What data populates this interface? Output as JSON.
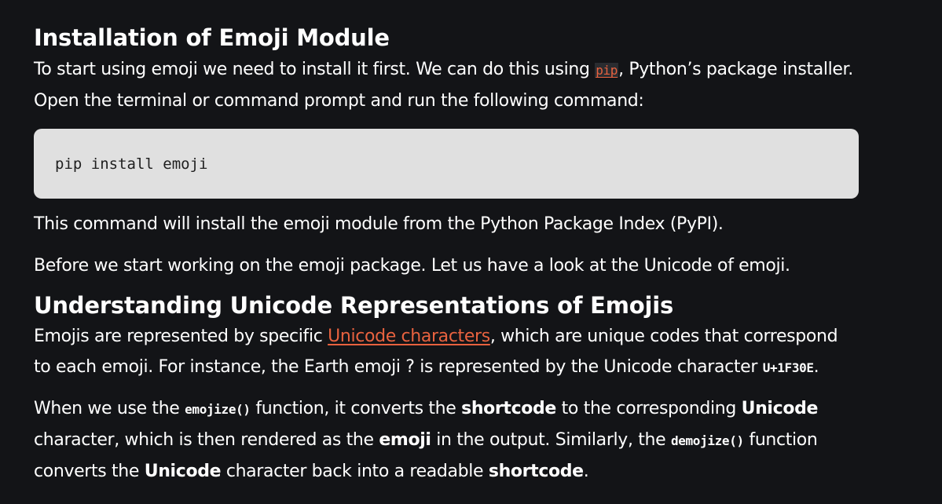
{
  "section1": {
    "heading": "Installation of Emoji Module",
    "para1_before": "To start using emoji we need to install it first. We can do this using ",
    "para1_link": "pip",
    "para1_after": ", Python’s package installer. Open the terminal or command prompt and run the following command:",
    "code": "pip install emoji",
    "para2": "This command will install the emoji module from the Python Package Index (PyPI).",
    "para3": "Before we start working on the emoji package. Let us have a look at the Unicode of emoji."
  },
  "section2": {
    "heading": "Understanding Unicode Representations of Emojis",
    "para1_before": "Emojis are represented by specific ",
    "para1_link": "Unicode characters",
    "para1_mid": ", which are unique codes that correspond to each emoji. For instance, the Earth emoji ? is represented by the Unicode character ",
    "para1_code": "U+1F30E",
    "para1_end": ".",
    "para2_a": "When we use the ",
    "para2_code1": "emojize()",
    "para2_b": " function, it converts the ",
    "para2_bold1": "shortcode",
    "para2_c": " to the corresponding ",
    "para2_bold2": "Unicode",
    "para2_d": " character, which is then rendered as the ",
    "para2_bold3": "emoji",
    "para2_e": " in the output. Similarly, the ",
    "para2_code2": "demojize()",
    "para2_f": " function converts the ",
    "para2_bold4": "Unicode",
    "para2_g": " character back into a readable ",
    "para2_bold5": "shortcode",
    "para2_h": "."
  },
  "colors": {
    "background": "#131417",
    "text": "#ffffff",
    "link": "#e8623f",
    "code_block_bg": "#e0e0e0"
  }
}
